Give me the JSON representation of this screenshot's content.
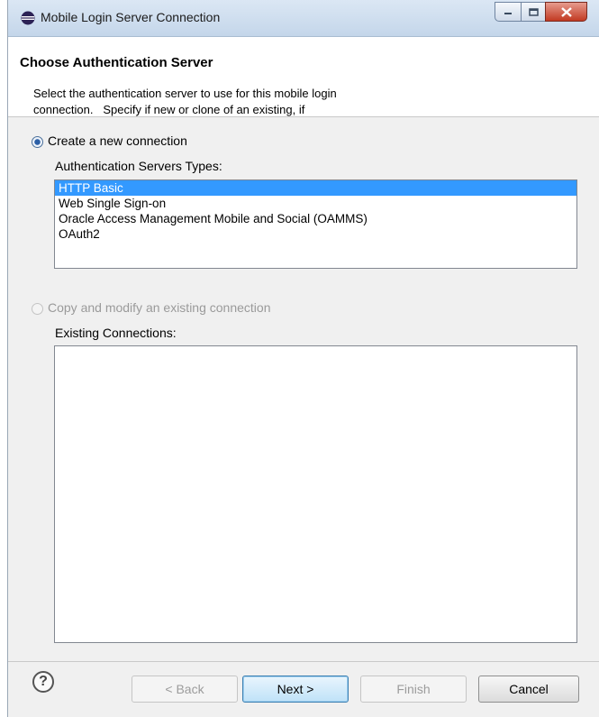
{
  "window": {
    "title": "Mobile Login Server Connection"
  },
  "window_buttons": {
    "minimize": "–",
    "maximize": "□",
    "close": "X"
  },
  "header": {
    "title": "Choose Authentication Server",
    "description_line1": "Select the authentication server to use for this mobile login",
    "description_line2": "connection.   Specify if new or clone of an existing, if"
  },
  "new_connection": {
    "label": "Create a new connection",
    "selected": true,
    "list_label": "Authentication Servers Types:",
    "items": [
      "HTTP Basic",
      "Web Single Sign-on",
      "Oracle Access Management Mobile and Social (OAMMS)",
      "OAuth2"
    ],
    "selected_index": 0
  },
  "existing_connection": {
    "label": "Copy and modify an existing connection",
    "selected": false,
    "list_label": "Existing Connections:"
  },
  "footer": {
    "help": "?",
    "back": "< Back",
    "next": "Next >",
    "finish": "Finish",
    "cancel": "Cancel"
  }
}
